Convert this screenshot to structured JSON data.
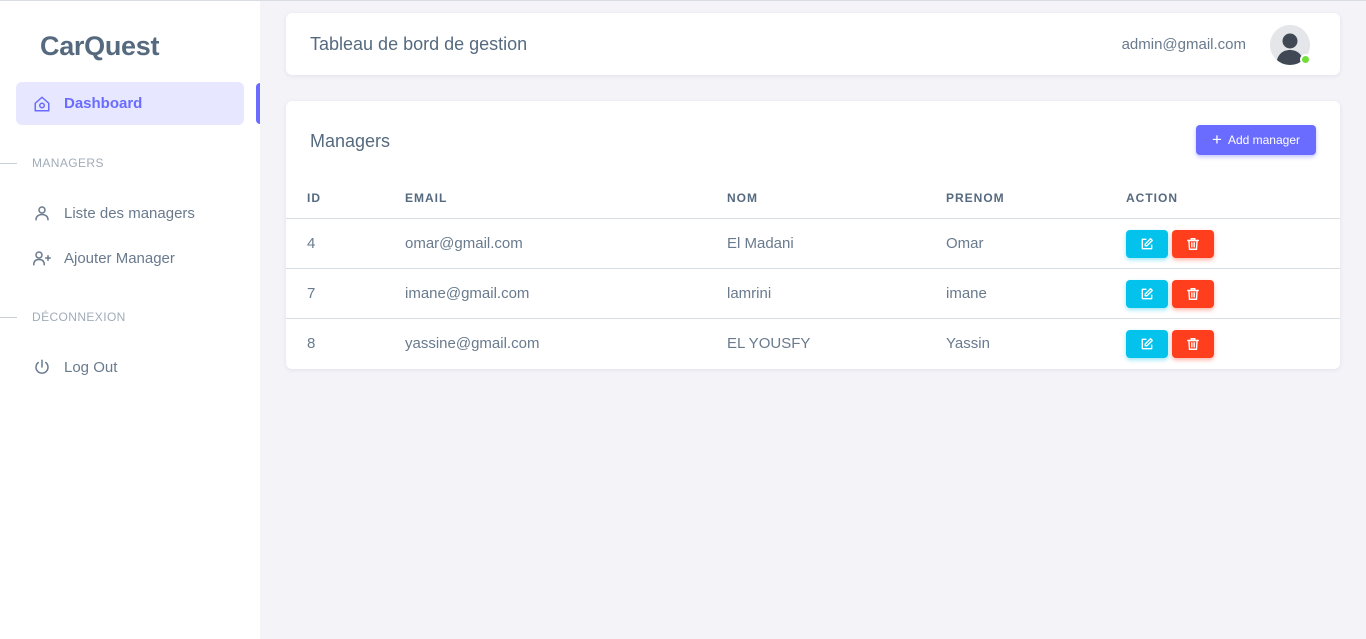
{
  "sidebar": {
    "brand": "CarQuest",
    "active_item": {
      "label": "Dashboard",
      "icon": "home-icon"
    },
    "sections": [
      {
        "header": "MANAGERS",
        "items": [
          {
            "label": "Liste des managers",
            "icon": "user-icon"
          },
          {
            "label": "Ajouter Manager",
            "icon": "user-plus-icon"
          }
        ]
      },
      {
        "header": "DÉCONNEXION",
        "items": [
          {
            "label": "Log Out",
            "icon": "power-icon"
          }
        ]
      }
    ]
  },
  "navbar": {
    "title": "Tableau de bord de gestion",
    "user_email": "admin@gmail.com",
    "status": "online"
  },
  "managers_card": {
    "title": "Managers",
    "add_button_label": "Add manager",
    "columns": [
      "ID",
      "EMAIL",
      "NOM",
      "PRENOM",
      "ACTION"
    ],
    "rows": [
      {
        "id": "4",
        "email": "omar@gmail.com",
        "nom": "El Madani",
        "prenom": "Omar"
      },
      {
        "id": "7",
        "email": "imane@gmail.com",
        "nom": "lamrini",
        "prenom": "imane"
      },
      {
        "id": "8",
        "email": "yassine@gmail.com",
        "nom": "EL YOUSFY",
        "prenom": "Yassin"
      }
    ]
  },
  "colors": {
    "accent": "#696cff",
    "edit": "#03c3ec",
    "delete": "#ff3e1d",
    "online": "#71dd37"
  }
}
